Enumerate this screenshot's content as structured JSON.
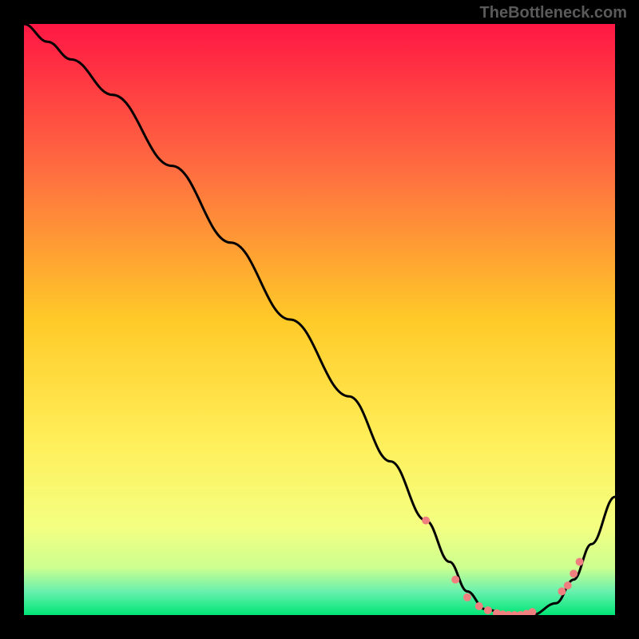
{
  "watermark": "TheBottleneck.com",
  "chart_data": {
    "type": "line",
    "title": "",
    "xlabel": "",
    "ylabel": "",
    "xlim": [
      0,
      100
    ],
    "ylim": [
      0,
      100
    ],
    "gradient_stops": [
      {
        "offset": 0,
        "color": "#ff1744"
      },
      {
        "offset": 25,
        "color": "#ff6e40"
      },
      {
        "offset": 50,
        "color": "#ffca28"
      },
      {
        "offset": 70,
        "color": "#ffee58"
      },
      {
        "offset": 85,
        "color": "#f4ff81"
      },
      {
        "offset": 92,
        "color": "#ccff90"
      },
      {
        "offset": 96,
        "color": "#69f0ae"
      },
      {
        "offset": 100,
        "color": "#00e676"
      }
    ],
    "series": [
      {
        "name": "bottleneck-curve",
        "color": "#000000",
        "x": [
          0,
          4,
          8,
          15,
          25,
          35,
          45,
          55,
          62,
          68,
          72,
          75,
          78,
          82,
          86,
          90,
          93,
          96,
          100
        ],
        "y": [
          100,
          97,
          94,
          88,
          76,
          63,
          50,
          37,
          26,
          16,
          9,
          4,
          1,
          0,
          0,
          2,
          6,
          12,
          20
        ]
      }
    ],
    "markers": {
      "name": "highlight-dots",
      "color": "#f08080",
      "points": [
        {
          "x": 68,
          "y": 16
        },
        {
          "x": 73,
          "y": 6
        },
        {
          "x": 75,
          "y": 3
        },
        {
          "x": 77,
          "y": 1.5
        },
        {
          "x": 78.5,
          "y": 0.8
        },
        {
          "x": 80,
          "y": 0.3
        },
        {
          "x": 81,
          "y": 0.1
        },
        {
          "x": 82,
          "y": 0
        },
        {
          "x": 83,
          "y": 0
        },
        {
          "x": 84,
          "y": 0
        },
        {
          "x": 85,
          "y": 0.2
        },
        {
          "x": 86,
          "y": 0.5
        },
        {
          "x": 91,
          "y": 4
        },
        {
          "x": 92,
          "y": 5
        },
        {
          "x": 93,
          "y": 7
        },
        {
          "x": 94,
          "y": 9
        }
      ]
    }
  }
}
